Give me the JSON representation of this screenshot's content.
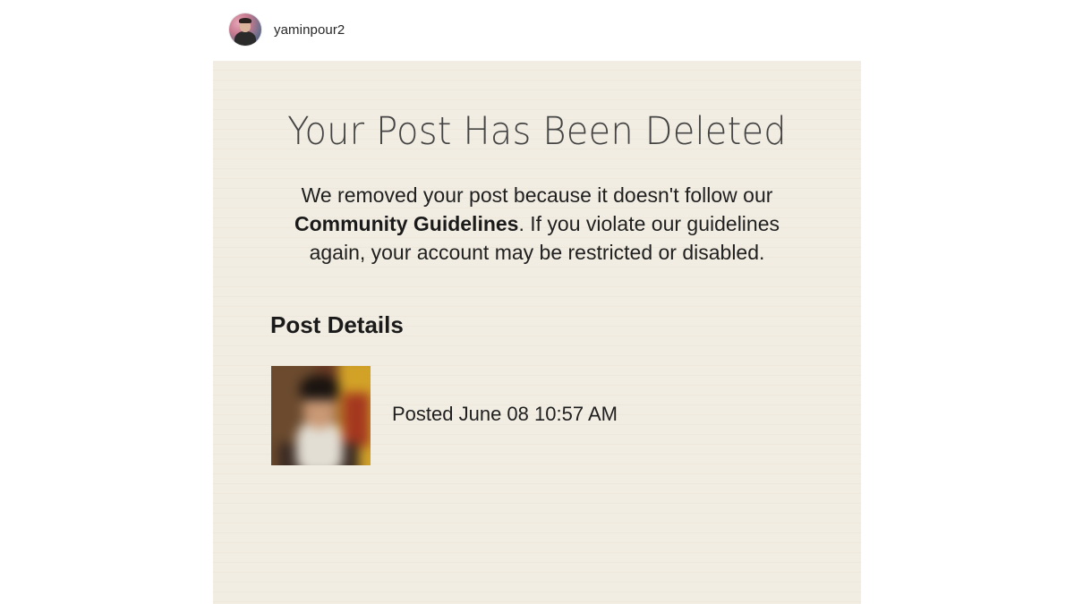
{
  "post": {
    "username": "yaminpour2"
  },
  "notice": {
    "title": "Your Post Has Been Deleted",
    "message_before": "We removed your post because it doesn't follow our ",
    "message_link": "Community Guidelines",
    "message_after": ". If you violate our guidelines again, your account may be restricted or disabled.",
    "details_heading": "Post Details",
    "posted_text": "Posted June 08 10:57 AM"
  },
  "colors": {
    "card_background": "#f2ede2",
    "text_primary": "#1f1f1f",
    "title_text": "#444444"
  },
  "icons": {
    "avatar": "user-avatar",
    "thumbnail": "post-thumbnail-blurred"
  }
}
